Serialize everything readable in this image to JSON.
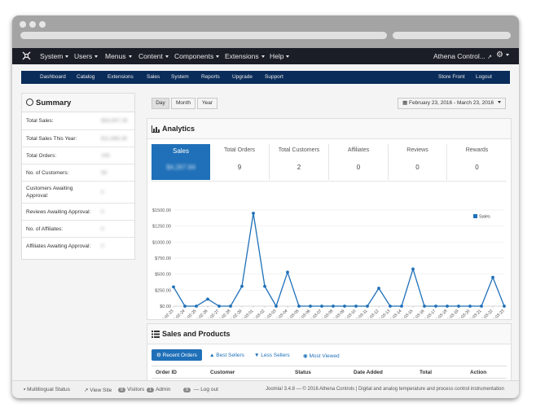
{
  "topnav": {
    "items": [
      "System",
      "Users",
      "Menus",
      "Content",
      "Components",
      "Extensions",
      "Help"
    ],
    "site_label": "Athena Control..."
  },
  "subnav": {
    "items": [
      "Dashboard",
      "Catalog",
      "Extensions",
      "Sales",
      "System",
      "Reports",
      "Upgrade",
      "Support"
    ],
    "right_items": [
      "Store Front",
      "Logout"
    ]
  },
  "summary": {
    "title": "Summary",
    "rows": [
      {
        "label": "Total Sales:",
        "value": "$58,897.36"
      },
      {
        "label": "Total Sales This Year:",
        "value": "$11,888.36"
      },
      {
        "label": "Total Orders:",
        "value": "195"
      },
      {
        "label": "No. of Customers:",
        "value": "58"
      },
      {
        "label": "Customers Awaiting Approval:",
        "value": "0"
      },
      {
        "label": "Reviews Awaiting Approval:",
        "value": "0"
      },
      {
        "label": "No. of Affiliates:",
        "value": "0"
      },
      {
        "label": "Affiliates Awaiting Approval:",
        "value": "0"
      }
    ]
  },
  "range": {
    "buttons": [
      "Day",
      "Month",
      "Year"
    ],
    "date_label": "February 23, 2016 - March 23, 2016"
  },
  "analytics": {
    "title": "Analytics",
    "stats": [
      {
        "label": "Sales",
        "value": "$4,267.84"
      },
      {
        "label": "Total Orders",
        "value": "9"
      },
      {
        "label": "Total Customers",
        "value": "2"
      },
      {
        "label": "Affiliates",
        "value": "0"
      },
      {
        "label": "Reviews",
        "value": "0"
      },
      {
        "label": "Rewards",
        "value": "0"
      }
    ]
  },
  "chart_data": {
    "type": "line",
    "title": "",
    "xlabel": "",
    "ylabel": "",
    "ylim": [
      0,
      1500
    ],
    "yticks": [
      "$0.00",
      "$250.00",
      "$500.00",
      "$750.00",
      "$1000.00",
      "$1250.00",
      "$1500.00"
    ],
    "grid": true,
    "legend": "top-right",
    "color": "#1f70b8",
    "series": [
      {
        "name": "Sales",
        "values": [
          300,
          0,
          0,
          110,
          0,
          0,
          310,
          1450,
          310,
          0,
          530,
          0,
          0,
          0,
          0,
          0,
          0,
          0,
          280,
          0,
          0,
          580,
          0,
          0,
          0,
          0,
          0,
          0,
          450,
          0
        ]
      }
    ],
    "x": [
      "2016-02-23",
      "2016-02-24",
      "2016-02-25",
      "2016-02-26",
      "2016-02-27",
      "2016-02-28",
      "2016-02-29",
      "2016-03-01",
      "2016-03-02",
      "2016-03-03",
      "2016-03-04",
      "2016-03-05",
      "2016-03-06",
      "2016-03-07",
      "2016-03-08",
      "2016-03-09",
      "2016-03-10",
      "2016-03-11",
      "2016-03-12",
      "2016-03-13",
      "2016-03-14",
      "2016-03-15",
      "2016-03-16",
      "2016-03-17",
      "2016-03-18",
      "2016-03-19",
      "2016-03-20",
      "2016-03-21",
      "2016-03-22",
      "2016-03-23"
    ]
  },
  "sales": {
    "title": "Sales and Products",
    "tabs": [
      "Recent Orders",
      "Best Sellers",
      "Less Sellers",
      "Most Viewed"
    ],
    "columns": [
      "Order ID",
      "Customer",
      "Status",
      "Date Added",
      "Total",
      "Action"
    ]
  },
  "footer": {
    "multilingual": "Multilingual Status",
    "view_site": "View Site",
    "visitors_count": "0",
    "visitors": "Visitors",
    "admin_count": "1",
    "admin": "Admin",
    "logout_count": "0",
    "logout": "Log out",
    "version": "Joomla! 3.4.8",
    "copyright": "— © 2016 Athena Controls | Digital and analog temperature and process control instrumentation"
  }
}
